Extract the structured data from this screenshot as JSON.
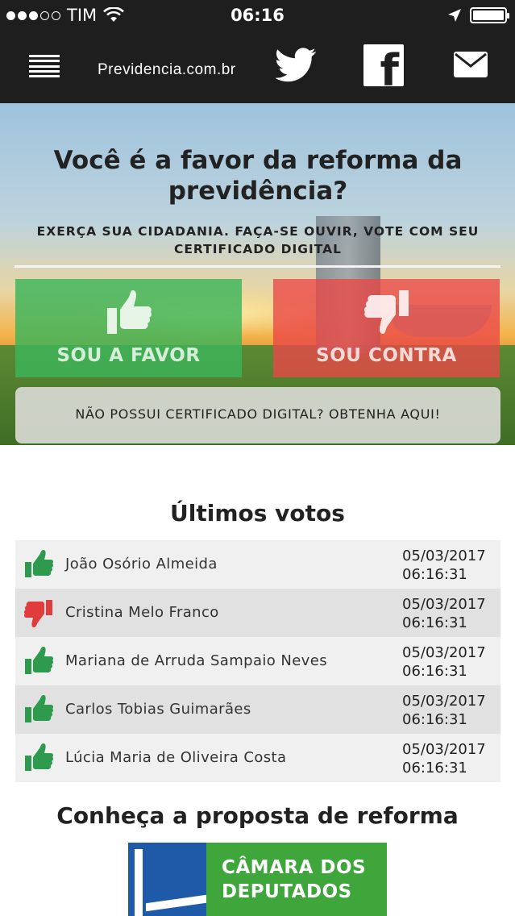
{
  "status_bar": {
    "carrier": "TIM",
    "time": "06:16"
  },
  "navbar": {
    "site_title": "Previdencia.com.br",
    "icons": [
      "menu-icon",
      "twitter-icon",
      "facebook-icon",
      "mail-icon"
    ]
  },
  "hero": {
    "title": "Você é a favor da reforma da previdência?",
    "subtitle": "EXERÇA SUA CIDADANIA. FAÇA-SE OUVIR, VOTE COM SEU CERTIFICADO DIGITAL",
    "vote_favor_label": "SOU A FAVOR",
    "vote_contra_label": "SOU CONTRA",
    "certificate_label": "NÃO POSSUI CERTIFICADO DIGITAL? OBTENHA AQUI!",
    "colors": {
      "favor": "#3cb45a",
      "contra": "#eb4646"
    }
  },
  "votes": {
    "title": "Últimos votos",
    "items": [
      {
        "name": "João Osório Almeida",
        "date": "05/03/2017",
        "time": "06:16:31",
        "vote": "favor"
      },
      {
        "name": "Cristina Melo Franco",
        "date": "05/03/2017",
        "time": "06:16:31",
        "vote": "contra"
      },
      {
        "name": "Mariana de Arruda Sampaio Neves",
        "date": "05/03/2017",
        "time": "06:16:31",
        "vote": "favor"
      },
      {
        "name": "Carlos Tobias Guimarães",
        "date": "05/03/2017",
        "time": "06:16:31",
        "vote": "favor"
      },
      {
        "name": "Lúcia Maria de Oliveira Costa",
        "date": "05/03/2017",
        "time": "06:16:31",
        "vote": "favor"
      }
    ],
    "colors": {
      "favor": "#2e9a4e",
      "contra": "#e03c3c"
    }
  },
  "proposal": {
    "title": "Conheça a proposta de reforma",
    "camara_line1": "CÂMARA DOS",
    "camara_line2": "DEPUTADOS"
  }
}
